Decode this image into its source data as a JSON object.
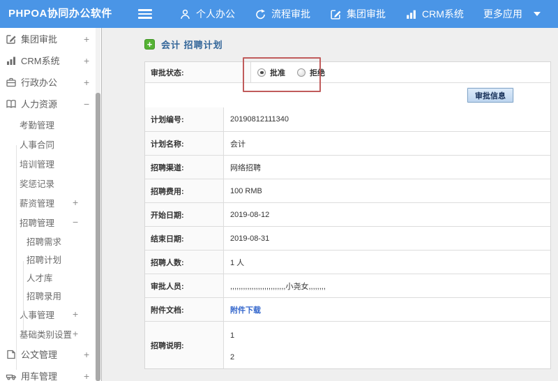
{
  "topbar": {
    "logo": "PHPOA协同办公软件",
    "nav": [
      {
        "name": "personal-office",
        "label": "个人办公",
        "icon": "user-icon"
      },
      {
        "name": "workflow-approval",
        "label": "流程审批",
        "icon": "process-arrow-icon"
      },
      {
        "name": "group-approval",
        "label": "集团审批",
        "icon": "edit-square-icon"
      },
      {
        "name": "crm-system",
        "label": "CRM系统",
        "icon": "bar-chart-icon"
      },
      {
        "name": "more-apps",
        "label": "更多应用",
        "icon": "caret-down-icon",
        "caret": true
      }
    ]
  },
  "sidebar": {
    "items": [
      {
        "name": "group-approval",
        "label": "集团审批",
        "level": 0,
        "icon": "edit-square-icon",
        "expand": "+"
      },
      {
        "name": "crm-system",
        "label": "CRM系统",
        "level": 0,
        "icon": "bar-chart-icon",
        "expand": "+"
      },
      {
        "name": "admin-office",
        "label": "行政办公",
        "level": 0,
        "icon": "briefcase-icon",
        "expand": "+"
      },
      {
        "name": "human-resources",
        "label": "人力资源",
        "level": 0,
        "icon": "book-icon",
        "expand": "−"
      },
      {
        "name": "attendance-mgmt",
        "label": "考勤管理",
        "level": 1
      },
      {
        "name": "hr-contract",
        "label": "人事合同",
        "level": 1
      },
      {
        "name": "training-mgmt",
        "label": "培训管理",
        "level": 1
      },
      {
        "name": "reward-punish",
        "label": "奖惩记录",
        "level": 1
      },
      {
        "name": "salary-mgmt",
        "label": "薪资管理",
        "level": 1,
        "expand": "+"
      },
      {
        "name": "recruit-mgmt",
        "label": "招聘管理",
        "level": 1,
        "expand": "−"
      },
      {
        "name": "recruit-demand",
        "label": "招聘需求",
        "level": 2
      },
      {
        "name": "recruit-plan",
        "label": "招聘计划",
        "level": 2
      },
      {
        "name": "talent-pool",
        "label": "人才库",
        "level": 2
      },
      {
        "name": "recruit-hire",
        "label": "招聘录用",
        "level": 2
      },
      {
        "name": "personnel-mgmt",
        "label": "人事管理",
        "level": 1,
        "expand": "+"
      },
      {
        "name": "base-category",
        "label": "基础类别设置",
        "level": 1,
        "expand": "+"
      },
      {
        "name": "document-mgmt",
        "label": "公文管理",
        "level": 0,
        "icon": "document-icon",
        "expand": "+"
      },
      {
        "name": "vehicle-mgmt",
        "label": "用车管理",
        "level": 0,
        "icon": "car-icon",
        "expand": "+"
      }
    ]
  },
  "main": {
    "title": "会计 招聘计划",
    "approval": {
      "status_label": "审批状态:",
      "options": [
        {
          "label": "批准",
          "selected": true
        },
        {
          "label": "拒绝",
          "selected": false
        }
      ],
      "button_label": "审批信息"
    },
    "fields": [
      {
        "name": "plan-number",
        "label": "计划编号:",
        "value": "20190812111340"
      },
      {
        "name": "plan-name",
        "label": "计划名称:",
        "value": "会计"
      },
      {
        "name": "recruit-channel",
        "label": "招聘渠道:",
        "value": "网络招聘"
      },
      {
        "name": "recruit-cost",
        "label": "招聘费用:",
        "value": "100 RMB"
      },
      {
        "name": "start-date",
        "label": "开始日期:",
        "value": "2019-08-12"
      },
      {
        "name": "end-date",
        "label": "结束日期:",
        "value": "2019-08-31"
      },
      {
        "name": "headcount",
        "label": "招聘人数:",
        "value": "1 人"
      },
      {
        "name": "approvers",
        "label": "审批人员:",
        "value": ",,,,,,,,,,,,,,,,,,,,,,,,,,小尧女,,,,,,,,"
      },
      {
        "name": "attachment",
        "label": "附件文档:",
        "value": "附件下载",
        "type": "link"
      },
      {
        "name": "recruit-note",
        "label": "招聘说明:",
        "value": "1\n2",
        "type": "multiline"
      }
    ]
  },
  "colors": {
    "topbar_bg": "#4a95e6",
    "title_text": "#336699",
    "annotation_red": "#c05b5b",
    "link_blue": "#3366cc",
    "green_plus": "#55b234",
    "button_bg_top": "#ddebfa",
    "button_bg_bottom": "#bdd5ef",
    "button_border": "#84a6c7",
    "button_text": "#122b54",
    "scrollbar_thumb": "#a9a9a9"
  }
}
